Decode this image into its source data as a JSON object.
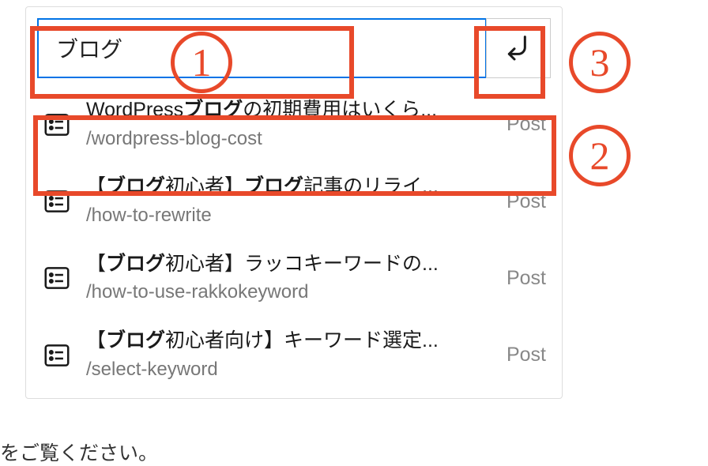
{
  "search": {
    "value": "ブログ"
  },
  "results": [
    {
      "title_pre": "WordPress",
      "title_bold": "ブログ",
      "title_post": "の初期費用はいくら...",
      "slug": "/wordpress-blog-cost",
      "type": "Post"
    },
    {
      "title_pre": "【",
      "title_bold": "ブログ",
      "title_mid": "初心者】",
      "title_bold2": "ブログ",
      "title_post": "記事のリライ...",
      "slug": "/how-to-rewrite",
      "type": "Post"
    },
    {
      "title_pre": "【",
      "title_bold": "ブログ",
      "title_post": "初心者】ラッコキーワードの...",
      "slug": "/how-to-use-rakkokeyword",
      "type": "Post"
    },
    {
      "title_pre": "【",
      "title_bold": "ブログ",
      "title_post": "初心者向け】キーワード選定...",
      "slug": "/select-keyword",
      "type": "Post"
    }
  ],
  "annotations": {
    "label1": "1",
    "label2": "2",
    "label3": "3"
  },
  "tail": "をご覧ください。"
}
